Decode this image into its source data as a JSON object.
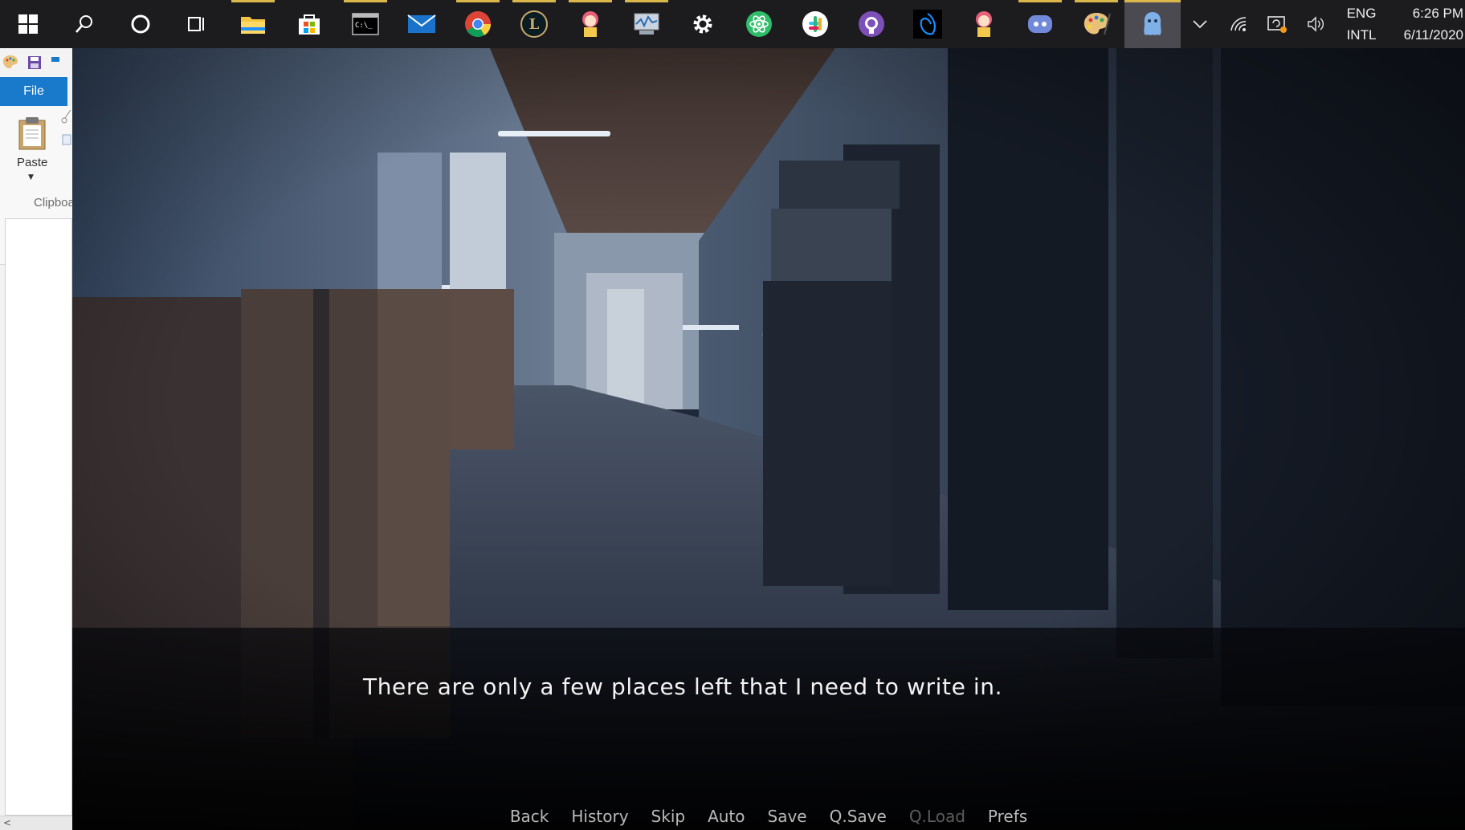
{
  "taskbar": {
    "apps": [
      {
        "name": "start-button",
        "icon": "windows-logo-icon"
      },
      {
        "name": "search-button",
        "icon": "search-icon"
      },
      {
        "name": "cortana-button",
        "icon": "cortana-circle-icon"
      },
      {
        "name": "task-view-button",
        "icon": "task-view-icon"
      },
      {
        "name": "file-explorer",
        "icon": "folder-icon",
        "color": "#f4c542"
      },
      {
        "name": "microsoft-store",
        "icon": "store-icon",
        "color": "#ffffff"
      },
      {
        "name": "command-prompt",
        "icon": "terminal-icon",
        "color": "#000000"
      },
      {
        "name": "mail",
        "icon": "mail-icon",
        "color": "#1a73c9"
      },
      {
        "name": "chrome",
        "icon": "chrome-icon"
      },
      {
        "name": "league-of-legends",
        "icon": "league-icon",
        "color": "#c8aa6e"
      },
      {
        "name": "anime-app",
        "icon": "character-icon",
        "color": "#f0b0c0"
      },
      {
        "name": "resource-monitor",
        "icon": "monitor-icon",
        "color": "#c9d4e0"
      },
      {
        "name": "settings",
        "icon": "gear-icon",
        "color": "#ffffff"
      },
      {
        "name": "atom",
        "icon": "atom-icon",
        "color": "#2fbd6a"
      },
      {
        "name": "slack",
        "icon": "slack-icon"
      },
      {
        "name": "github-desktop",
        "icon": "github-icon",
        "color": "#7d4fb8"
      },
      {
        "name": "battle-net",
        "icon": "battlenet-icon",
        "color": "#148eff"
      },
      {
        "name": "anime-app-2",
        "icon": "character-icon",
        "color": "#f0b0c0"
      },
      {
        "name": "discord",
        "icon": "discord-icon",
        "color": "#7289da"
      },
      {
        "name": "paint",
        "icon": "palette-icon",
        "color": "#e8c07a"
      },
      {
        "name": "game-window",
        "icon": "ghost-icon",
        "color": "#7fb0e8"
      }
    ],
    "tray": {
      "chevron": "chevron-up-icon",
      "wifi": "wifi-icon",
      "sync": "sync-icon",
      "volume": "volume-icon",
      "lang_top": "ENG",
      "lang_bottom": "INTL",
      "time": "6:26 PM",
      "date": "6/11/2020"
    }
  },
  "paint": {
    "file_label": "File",
    "paste_label": "Paste",
    "clipboard_label": "Clipboard"
  },
  "game": {
    "dialogue": "There are only a few places left that I need to write in.",
    "quick_menu": [
      {
        "label": "Back",
        "enabled": true
      },
      {
        "label": "History",
        "enabled": true
      },
      {
        "label": "Skip",
        "enabled": true
      },
      {
        "label": "Auto",
        "enabled": true
      },
      {
        "label": "Save",
        "enabled": true
      },
      {
        "label": "Q.Save",
        "enabled": true
      },
      {
        "label": "Q.Load",
        "enabled": false
      },
      {
        "label": "Prefs",
        "enabled": true
      }
    ]
  }
}
